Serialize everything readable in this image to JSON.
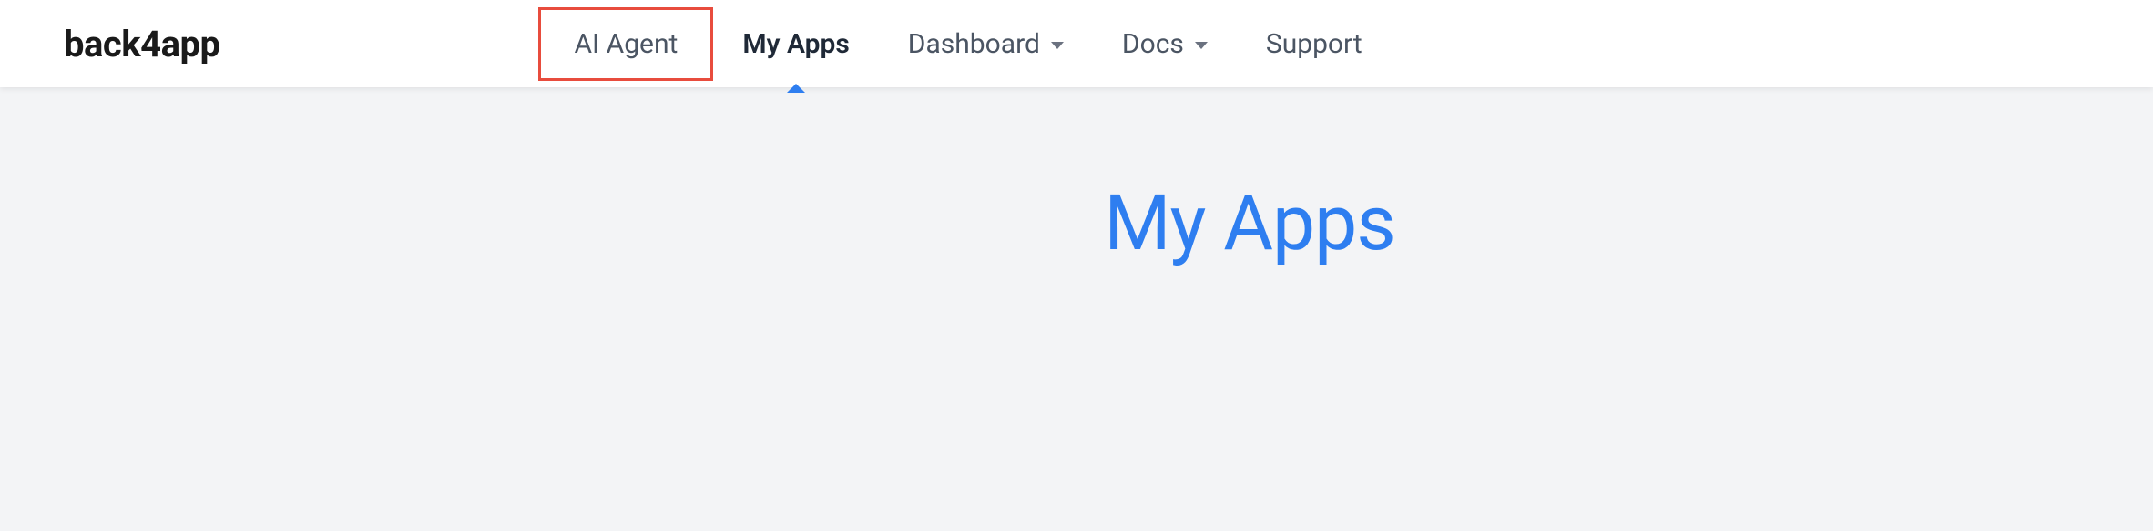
{
  "header": {
    "logo": "back4app",
    "nav": {
      "ai_agent": "AI Agent",
      "my_apps": "My Apps",
      "dashboard": "Dashboard",
      "docs": "Docs",
      "support": "Support"
    }
  },
  "main": {
    "title": "My Apps"
  },
  "colors": {
    "accent": "#2e7ef0",
    "highlight_border": "#e84c3d"
  }
}
